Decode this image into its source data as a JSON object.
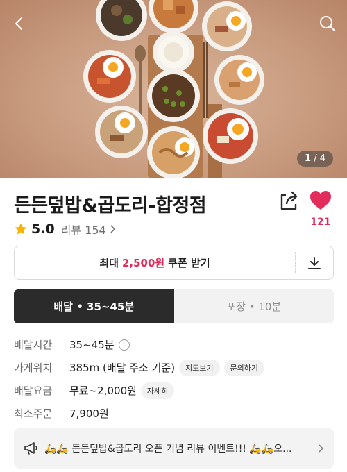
{
  "hero": {
    "pager_current": "1",
    "pager_total": "/ 4",
    "back_icon": "chevron-left-icon",
    "search_icon": "search-icon"
  },
  "store": {
    "name": "든든덮밥&곱도리-합정점",
    "like_count": "121",
    "rating": "5.0",
    "reviews_label": "리뷰 154",
    "share_icon": "share-icon",
    "heart_icon": "heart-icon"
  },
  "coupon": {
    "prefix": "최대",
    "amount": "2,500원",
    "suffix": "쿠폰 받기",
    "download_icon": "download-icon"
  },
  "tabs": [
    {
      "label": "배달 • 35~45분",
      "active": true
    },
    {
      "label": "포장 • 10분",
      "active": false
    }
  ],
  "info": {
    "delivery_time_label": "배달시간",
    "delivery_time_value": "35~45분",
    "location_label": "가게위치",
    "location_value": "385m (배달 주소 기준)",
    "map_button": "지도보기",
    "inquiry_button": "문의하기",
    "fee_label": "배달요금",
    "fee_free": "무료",
    "fee_value": "~2,000원",
    "fee_detail_button": "자세히",
    "min_order_label": "최소주문",
    "min_order_value": "7,900원"
  },
  "notice": {
    "text": "🛵🛵 든든덮밥&곱도리 오픈 기념 리뷰 이벤트!!! 🛵🛵오...",
    "icon": "megaphone-icon"
  },
  "colors": {
    "accent": "#e22c5b",
    "tab_active_bg": "#2b2b2b"
  }
}
